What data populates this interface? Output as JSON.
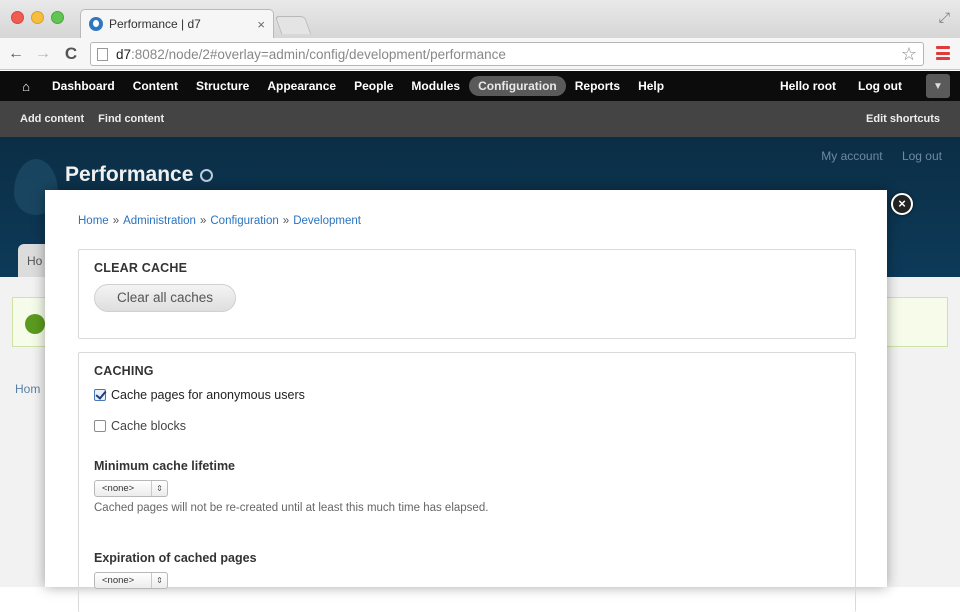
{
  "browser": {
    "tab_title": "Performance | d7",
    "tab_close": "×",
    "url_host": "d7",
    "url_rest": ":8082/node/2#overlay=admin/config/development/performance",
    "back_label": "←",
    "forward_label": "→",
    "reload_label": "C",
    "fullscreen_label": "⤢",
    "star_label": "☆"
  },
  "admin_toolbar": {
    "home_label": "⌂",
    "items": [
      {
        "label": "Dashboard"
      },
      {
        "label": "Content"
      },
      {
        "label": "Structure"
      },
      {
        "label": "Appearance"
      },
      {
        "label": "People"
      },
      {
        "label": "Modules"
      },
      {
        "label": "Configuration",
        "active": true
      },
      {
        "label": "Reports"
      },
      {
        "label": "Help"
      }
    ],
    "user_greeting": "Hello root",
    "logout_label": "Log out",
    "toggle_label": "▼"
  },
  "shortcuts": {
    "items": [
      "Add content",
      "Find content"
    ],
    "edit_label": "Edit shortcuts"
  },
  "background_page": {
    "title": "Performance",
    "secondary_links": [
      "My account",
      "Log out"
    ],
    "tab_label": "Ho",
    "breadcrumb_fragment": "Hom"
  },
  "overlay": {
    "close_label": "×",
    "breadcrumb": [
      "Home",
      "Administration",
      "Configuration",
      "Development"
    ],
    "breadcrumb_sep": "»",
    "clear_cache": {
      "legend": "CLEAR CACHE",
      "button_label": "Clear all caches"
    },
    "caching": {
      "legend": "CACHING",
      "cache_pages_label": "Cache pages for anonymous users",
      "cache_pages_checked": true,
      "cache_blocks_label": "Cache blocks",
      "cache_blocks_checked": false,
      "min_lifetime_label": "Minimum cache lifetime",
      "min_lifetime_value": "<none>",
      "min_lifetime_description": "Cached pages will not be re-created until at least this much time has elapsed.",
      "expiration_label": "Expiration of cached pages",
      "expiration_value": "<none>"
    }
  },
  "colors": {
    "admin_bar": "#0c0c0c",
    "shortcut_bar": "#444444",
    "header": "#0d3a59",
    "link": "#2a73c0"
  }
}
